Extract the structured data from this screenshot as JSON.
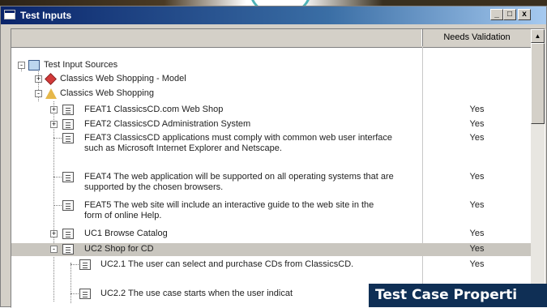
{
  "window": {
    "title": "Test Inputs",
    "controls": {
      "minimize": "_",
      "maximize": "□",
      "close": "x"
    }
  },
  "columns": {
    "main": "",
    "needs_validation": "Needs Validation"
  },
  "tree": [
    {
      "label": "Test Input Sources",
      "icon": "root-folder-icon",
      "expander": "-",
      "validation": ""
    },
    {
      "label": "Classics Web Shopping - Model",
      "icon": "model-icon",
      "expander": "+",
      "validation": ""
    },
    {
      "label": "Classics Web Shopping",
      "icon": "project-icon",
      "expander": "-",
      "validation": ""
    },
    {
      "label": "FEAT1 ClassicsCD.com Web Shop",
      "icon": "document-icon",
      "expander": "+",
      "validation": "Yes"
    },
    {
      "label": "FEAT2 ClassicsCD Administration System",
      "icon": "document-icon",
      "expander": "+",
      "validation": "Yes"
    },
    {
      "label": "FEAT3 ClassicsCD applications must comply with common web user interface such as Microsoft Internet Explorer and Netscape.",
      "icon": "document-icon",
      "expander": "",
      "validation": "Yes"
    },
    {
      "label": "FEAT4 The web application will be supported on all operating systems that are supported by the chosen browsers.",
      "icon": "document-icon",
      "expander": "",
      "validation": "Yes"
    },
    {
      "label": "FEAT5 The web site will include an interactive guide to the web site in the form of online Help.",
      "icon": "document-icon",
      "expander": "",
      "validation": "Yes"
    },
    {
      "label": "UC1 Browse Catalog",
      "icon": "document-icon",
      "expander": "+",
      "validation": "Yes"
    },
    {
      "label": "UC2 Shop for CD",
      "icon": "document-icon",
      "expander": "-",
      "validation": "Yes"
    },
    {
      "label": "UC2.1 The user can select and purchase CDs from ClassicsCD.",
      "icon": "document-icon",
      "expander": "",
      "validation": "Yes"
    },
    {
      "label": "UC2.2 The use case starts when the user indicat",
      "icon": "document-icon",
      "expander": "",
      "validation": ""
    }
  ],
  "overlay_caption": "Test Case Properti",
  "colors": {
    "titlebar_start": "#0a246a",
    "titlebar_end": "#a6caf0",
    "selection": "#c9c6bf",
    "overlay": "#0f2f55",
    "window_face": "#d4d0c8"
  }
}
